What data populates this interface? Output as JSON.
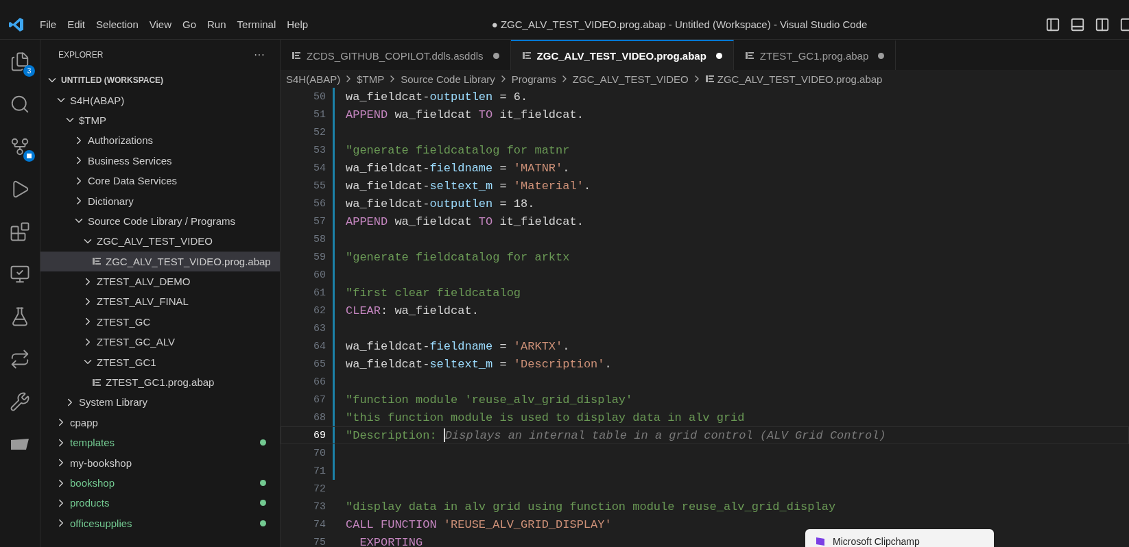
{
  "window": {
    "title": "● ZGC_ALV_TEST_VIDEO.prog.abap - Untitled (Workspace) - Visual Studio Code"
  },
  "menu": [
    "File",
    "Edit",
    "Selection",
    "View",
    "Go",
    "Run",
    "Terminal",
    "Help"
  ],
  "activity_bar": [
    {
      "kind": "explorer",
      "badge": "3"
    },
    {
      "kind": "search"
    },
    {
      "kind": "source_control",
      "badge_icon": true
    },
    {
      "kind": "run"
    },
    {
      "kind": "extensions"
    },
    {
      "kind": "remote"
    },
    {
      "kind": "testing"
    },
    {
      "kind": "sync"
    },
    {
      "kind": "tools"
    },
    {
      "kind": "panel"
    }
  ],
  "sidebar": {
    "title": "EXPLORER",
    "more": "···",
    "tree": [
      {
        "label": "UNTITLED (WORKSPACE)",
        "kind": "root",
        "expanded": true,
        "children": [
          {
            "label": "S4H(ABAP)",
            "kind": "folder",
            "expanded": true,
            "added": false,
            "children": [
              {
                "label": "$TMP",
                "kind": "folder",
                "expanded": true,
                "added": false,
                "children": [
                  {
                    "label": "Authorizations",
                    "kind": "folder",
                    "expanded": false,
                    "added": false
                  },
                  {
                    "label": "Business Services",
                    "kind": "folder",
                    "expanded": false,
                    "added": false
                  },
                  {
                    "label": "Core Data Services",
                    "kind": "folder",
                    "expanded": false,
                    "added": false
                  },
                  {
                    "label": "Dictionary",
                    "kind": "folder",
                    "expanded": false,
                    "added": false
                  },
                  {
                    "label": "Source Code Library / Programs",
                    "kind": "folder",
                    "expanded": true,
                    "added": false,
                    "children": [
                      {
                        "label": "ZGC_ALV_TEST_VIDEO",
                        "kind": "folder",
                        "expanded": true,
                        "added": false,
                        "children": [
                          {
                            "label": "ZGC_ALV_TEST_VIDEO.prog.abap",
                            "kind": "file",
                            "selected": true,
                            "added": false
                          }
                        ]
                      },
                      {
                        "label": "ZTEST_ALV_DEMO",
                        "kind": "folder",
                        "expanded": false,
                        "added": false
                      },
                      {
                        "label": "ZTEST_ALV_FINAL",
                        "kind": "folder",
                        "expanded": false,
                        "added": false
                      },
                      {
                        "label": "ZTEST_GC",
                        "kind": "folder",
                        "expanded": false,
                        "added": false
                      },
                      {
                        "label": "ZTEST_GC_ALV",
                        "kind": "folder",
                        "expanded": false,
                        "added": false
                      },
                      {
                        "label": "ZTEST_GC1",
                        "kind": "folder",
                        "expanded": true,
                        "added": false,
                        "children": [
                          {
                            "label": "ZTEST_GC1.prog.abap",
                            "kind": "file",
                            "selected": false,
                            "added": false
                          }
                        ]
                      }
                    ]
                  }
                ]
              },
              {
                "label": "System Library",
                "kind": "folder",
                "expanded": false,
                "added": false
              }
            ]
          },
          {
            "label": "cpapp",
            "kind": "folder",
            "expanded": false,
            "added": false
          },
          {
            "label": "templates",
            "kind": "folder",
            "expanded": false,
            "added": true
          },
          {
            "label": "my-bookshop",
            "kind": "folder",
            "expanded": false,
            "added": false
          },
          {
            "label": "bookshop",
            "kind": "folder",
            "expanded": false,
            "added": true
          },
          {
            "label": "products",
            "kind": "folder",
            "expanded": false,
            "added": true
          },
          {
            "label": "officesupplies",
            "kind": "folder",
            "expanded": false,
            "added": true
          }
        ]
      }
    ]
  },
  "tabs": [
    {
      "label": "ZCDS_GITHUB_COPILOT.ddls.asddls",
      "selected": false,
      "dirty": true
    },
    {
      "label": "ZGC_ALV_TEST_VIDEO.prog.abap",
      "selected": true,
      "dirty": true
    },
    {
      "label": "ZTEST_GC1.prog.abap",
      "selected": false,
      "dirty": true
    }
  ],
  "breadcrumb": [
    {
      "label": "S4H(ABAP)",
      "kind": "folder"
    },
    {
      "label": "$TMP",
      "kind": "folder"
    },
    {
      "label": "Source Code Library",
      "kind": "folder"
    },
    {
      "label": "Programs",
      "kind": "folder"
    },
    {
      "label": "ZGC_ALV_TEST_VIDEO",
      "kind": "folder"
    },
    {
      "label": "ZGC_ALV_TEST_VIDEO.prog.abap",
      "kind": "file"
    }
  ],
  "editor": {
    "lines": [
      {
        "n": "50",
        "modified": true,
        "tokens": [
          {
            "kind": "plain",
            "text": "wa_fieldcat-"
          },
          {
            "kind": "field",
            "text": "outputlen"
          },
          {
            "kind": "plain",
            "text": " = 6."
          }
        ]
      },
      {
        "n": "51",
        "modified": true,
        "tokens": [
          {
            "kind": "keyword",
            "text": "APPEND"
          },
          {
            "kind": "plain",
            "text": " wa_fieldcat "
          },
          {
            "kind": "keyword",
            "text": "TO"
          },
          {
            "kind": "plain",
            "text": " it_fieldcat."
          }
        ]
      },
      {
        "n": "52",
        "modified": true
      },
      {
        "n": "53",
        "modified": true,
        "tokens": [
          {
            "kind": "comment",
            "text": "\"generate fieldcatalog for matnr"
          }
        ]
      },
      {
        "n": "54",
        "modified": true,
        "tokens": [
          {
            "kind": "plain",
            "text": "wa_fieldcat-"
          },
          {
            "kind": "field",
            "text": "fieldname"
          },
          {
            "kind": "plain",
            "text": " = "
          },
          {
            "kind": "string",
            "text": "'MATNR'"
          },
          {
            "kind": "plain",
            "text": "."
          }
        ]
      },
      {
        "n": "55",
        "modified": true,
        "tokens": [
          {
            "kind": "plain",
            "text": "wa_fieldcat-"
          },
          {
            "kind": "field",
            "text": "seltext_m"
          },
          {
            "kind": "plain",
            "text": " = "
          },
          {
            "kind": "string",
            "text": "'Material'"
          },
          {
            "kind": "plain",
            "text": "."
          }
        ]
      },
      {
        "n": "56",
        "modified": true,
        "tokens": [
          {
            "kind": "plain",
            "text": "wa_fieldcat-"
          },
          {
            "kind": "field",
            "text": "outputlen"
          },
          {
            "kind": "plain",
            "text": " = 18."
          }
        ]
      },
      {
        "n": "57",
        "modified": true,
        "tokens": [
          {
            "kind": "keyword",
            "text": "APPEND"
          },
          {
            "kind": "plain",
            "text": " wa_fieldcat "
          },
          {
            "kind": "keyword",
            "text": "TO"
          },
          {
            "kind": "plain",
            "text": " it_fieldcat."
          }
        ]
      },
      {
        "n": "58",
        "modified": true
      },
      {
        "n": "59",
        "modified": true,
        "tokens": [
          {
            "kind": "comment",
            "text": "\"generate fieldcatalog for arktx"
          }
        ]
      },
      {
        "n": "60",
        "modified": true
      },
      {
        "n": "61",
        "modified": true,
        "tokens": [
          {
            "kind": "comment",
            "text": "\"first clear fieldcatalog"
          }
        ]
      },
      {
        "n": "62",
        "modified": true,
        "tokens": [
          {
            "kind": "keyword",
            "text": "CLEAR"
          },
          {
            "kind": "plain",
            "text": ": wa_fieldcat."
          }
        ]
      },
      {
        "n": "63",
        "modified": true
      },
      {
        "n": "64",
        "modified": true,
        "tokens": [
          {
            "kind": "plain",
            "text": "wa_fieldcat-"
          },
          {
            "kind": "field",
            "text": "fieldname"
          },
          {
            "kind": "plain",
            "text": " = "
          },
          {
            "kind": "string",
            "text": "'ARKTX'"
          },
          {
            "kind": "plain",
            "text": "."
          }
        ]
      },
      {
        "n": "65",
        "modified": true,
        "tokens": [
          {
            "kind": "plain",
            "text": "wa_fieldcat-"
          },
          {
            "kind": "field",
            "text": "seltext_m"
          },
          {
            "kind": "plain",
            "text": " = "
          },
          {
            "kind": "string",
            "text": "'Description'"
          },
          {
            "kind": "plain",
            "text": "."
          }
        ]
      },
      {
        "n": "66",
        "modified": true
      },
      {
        "n": "67",
        "modified": true,
        "tokens": [
          {
            "kind": "comment",
            "text": "\"function module 'reuse_alv_grid_display'"
          }
        ]
      },
      {
        "n": "68",
        "modified": true,
        "tokens": [
          {
            "kind": "comment",
            "text": "\"this function module is used to display data in alv grid"
          }
        ]
      },
      {
        "n": "69",
        "modified": true,
        "cursor": true,
        "tokens": [
          {
            "kind": "comment",
            "text": "\"Description: "
          }
        ],
        "suggestion": "Displays an internal table in a grid control (ALV Grid Control)"
      },
      {
        "n": "70",
        "modified": true
      },
      {
        "n": "71",
        "modified": true
      },
      {
        "n": "72",
        "modified": false
      },
      {
        "n": "73",
        "modified": false,
        "tokens": [
          {
            "kind": "comment",
            "text": "\"display data in alv grid using function module reuse_alv_grid_display"
          }
        ]
      },
      {
        "n": "74",
        "modified": false,
        "tokens": [
          {
            "kind": "keyword",
            "text": "CALL FUNCTION"
          },
          {
            "kind": "string",
            "text": " 'REUSE_ALV_GRID_DISPLAY'"
          }
        ]
      },
      {
        "n": "75",
        "modified": false,
        "tokens": [
          {
            "kind": "keyword",
            "text": "  EXPORTING"
          }
        ]
      }
    ]
  },
  "notification": {
    "title": "Microsoft Clipchamp"
  }
}
